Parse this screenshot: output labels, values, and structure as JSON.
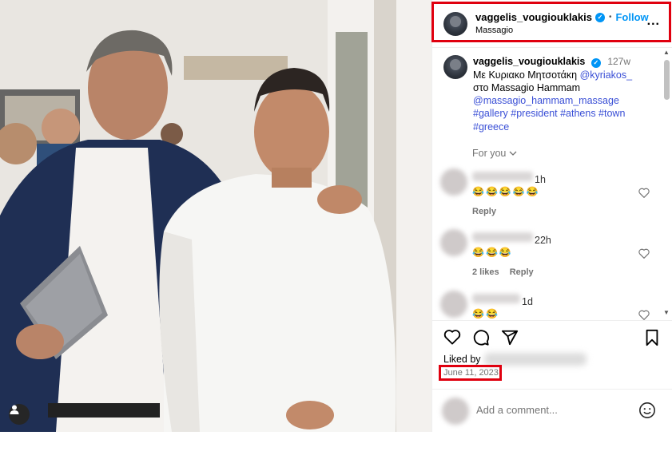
{
  "post": {
    "username": "vaggelis_vougiouklakis",
    "verified_icon": "verified-badge-icon",
    "dot": "•",
    "follow_label": "Follow",
    "location": "Massagio",
    "more_icon": "more-options-icon",
    "more_label": "..."
  },
  "caption": {
    "username": "vaggelis_vougiouklakis",
    "time": "127w",
    "text_line1": "Με Κυριακο Μητσοτάκη",
    "mention1": "@kyriakos_",
    "text_line2": "στο Massagio Hammam",
    "mention2": "@massagio_hammam_massage",
    "hashtags_line1": "#gallery #president #athens #town",
    "hashtags_line2": "#greece"
  },
  "sort": {
    "label": "For you",
    "chevron_icon": "chevron-down-icon"
  },
  "comments": [
    {
      "time": "1h",
      "emoji": "😂😂😂😂😂",
      "likes": "",
      "reply": "Reply"
    },
    {
      "time": "22h",
      "emoji": "😂😂😂",
      "likes": "2 likes",
      "reply": "Reply"
    },
    {
      "time": "1d",
      "emoji": "😂😂",
      "likes": "",
      "reply": ""
    }
  ],
  "actions": {
    "like_icon": "heart-icon",
    "comment_icon": "comment-icon",
    "share_icon": "share-icon",
    "save_icon": "bookmark-icon"
  },
  "liked_by_label": "Liked by",
  "date": "June 11, 2023",
  "add_comment": {
    "placeholder": "Add a comment...",
    "emoji_icon": "emoji-icon"
  },
  "colors": {
    "highlight": "#e0000f",
    "link": "#3a4fd6",
    "follow": "#0095f6"
  }
}
